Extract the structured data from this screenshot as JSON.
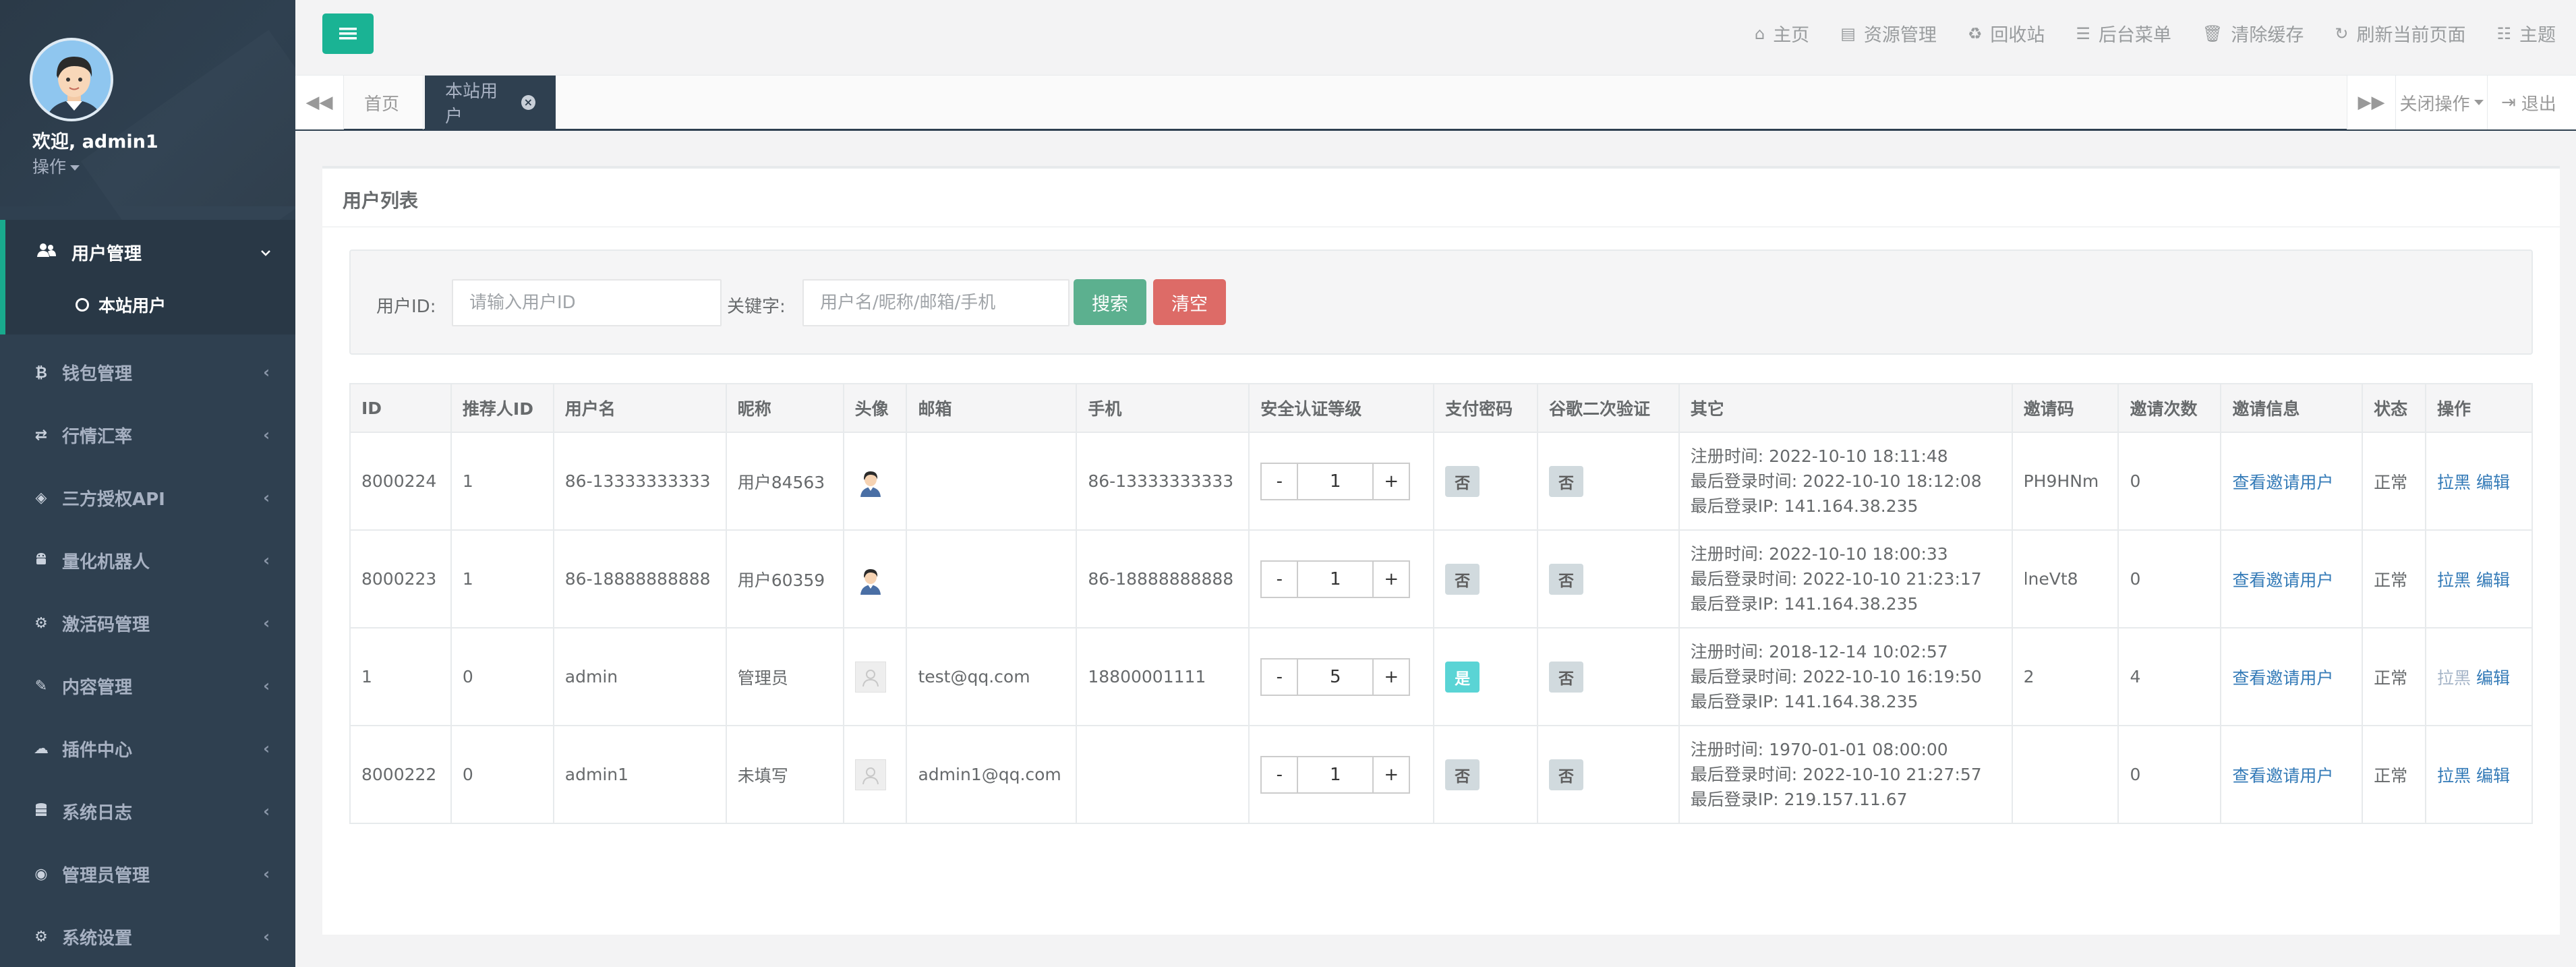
{
  "sidebar": {
    "welcome": "欢迎, admin1",
    "profile_menu": "操作",
    "active_group": {
      "label": "用户管理",
      "sub_item": "本站用户"
    },
    "items": [
      {
        "label": "钱包管理",
        "icon": "bitcoin-icon"
      },
      {
        "label": "行情汇率",
        "icon": "exchange-icon"
      },
      {
        "label": "三方授权API",
        "icon": "api-icon"
      },
      {
        "label": "量化机器人",
        "icon": "android-icon"
      },
      {
        "label": "激活码管理",
        "icon": "gear-icon"
      },
      {
        "label": "内容管理",
        "icon": "edit-icon"
      },
      {
        "label": "插件中心",
        "icon": "cloud-icon"
      },
      {
        "label": "系统日志",
        "icon": "database-icon"
      },
      {
        "label": "管理员管理",
        "icon": "user-circle-icon"
      },
      {
        "label": "系统设置",
        "icon": "gears-icon"
      }
    ]
  },
  "topbar": {
    "links": [
      {
        "label": "主页",
        "icon": "home-icon"
      },
      {
        "label": "资源管理",
        "icon": "file-icon"
      },
      {
        "label": "回收站",
        "icon": "recycle-icon"
      },
      {
        "label": "后台菜单",
        "icon": "list-icon"
      },
      {
        "label": "清除缓存",
        "icon": "trash-icon"
      },
      {
        "label": "刷新当前页面",
        "icon": "refresh-icon"
      },
      {
        "label": "主题",
        "icon": "theme-icon"
      }
    ]
  },
  "tabs": {
    "home": "首页",
    "active": "本站用户",
    "close_ops": "关闭操作",
    "logout": "退出"
  },
  "panel": {
    "title": "用户列表",
    "search": {
      "user_id_label": "用户ID:",
      "user_id_placeholder": "请输入用户ID",
      "keyword_label": "关键字:",
      "keyword_placeholder": "用户名/昵称/邮箱/手机",
      "search_btn": "搜索",
      "clear_btn": "清空"
    }
  },
  "table": {
    "headers": [
      "ID",
      "推荐人ID",
      "用户名",
      "昵称",
      "头像",
      "邮箱",
      "手机",
      "安全认证等级",
      "支付密码",
      "谷歌二次验证",
      "其它",
      "邀请码",
      "邀请次数",
      "邀请信息",
      "状态",
      "操作"
    ],
    "rows": [
      {
        "id": "8000224",
        "ref": "1",
        "username": "86-13333333333",
        "nick": "用户84563",
        "avatar": "man",
        "email": "",
        "phone": "86-13333333333",
        "level": "1",
        "pay": "否",
        "pay_yes": false,
        "google": "否",
        "reg": "注册时间: 2022-10-10 18:11:48",
        "last": "最后登录时间: 2022-10-10 18:12:08",
        "ip": "最后登录IP: 141.164.38.235",
        "code": "PH9HNm",
        "count": "0",
        "invite": "查看邀请用户",
        "status": "正常",
        "black": "拉黑",
        "edit": "编辑",
        "black_muted": false
      },
      {
        "id": "8000223",
        "ref": "1",
        "username": "86-18888888888",
        "nick": "用户60359",
        "avatar": "man",
        "email": "",
        "phone": "86-18888888888",
        "level": "1",
        "pay": "否",
        "pay_yes": false,
        "google": "否",
        "reg": "注册时间: 2022-10-10 18:00:33",
        "last": "最后登录时间: 2022-10-10 21:23:17",
        "ip": "最后登录IP: 141.164.38.235",
        "code": "lneVt8",
        "count": "0",
        "invite": "查看邀请用户",
        "status": "正常",
        "black": "拉黑",
        "edit": "编辑",
        "black_muted": false
      },
      {
        "id": "1",
        "ref": "0",
        "username": "admin",
        "nick": "管理员",
        "avatar": "gray",
        "email": "test@qq.com",
        "phone": "18800001111",
        "level": "5",
        "pay": "是",
        "pay_yes": true,
        "google": "否",
        "reg": "注册时间: 2018-12-14 10:02:57",
        "last": "最后登录时间: 2022-10-10 16:19:50",
        "ip": "最后登录IP: 141.164.38.235",
        "code": "2",
        "count": "4",
        "invite": "查看邀请用户",
        "status": "正常",
        "black": "拉黑",
        "edit": "编辑",
        "black_muted": true
      },
      {
        "id": "8000222",
        "ref": "0",
        "username": "admin1",
        "nick": "未填写",
        "avatar": "gray",
        "email": "admin1@qq.com",
        "phone": "",
        "level": "1",
        "pay": "否",
        "pay_yes": false,
        "google": "否",
        "reg": "注册时间: 1970-01-01 08:00:00",
        "last": "最后登录时间: 2022-10-10 21:27:57",
        "ip": "最后登录IP: 219.157.11.67",
        "code": "",
        "count": "0",
        "invite": "查看邀请用户",
        "status": "正常",
        "black": "拉黑",
        "edit": "编辑",
        "black_muted": false
      }
    ]
  },
  "colors": {
    "sidebar_bg": "#2f4050",
    "accent": "#1ab394",
    "search_btn": "#5cb08f",
    "clear_btn": "#d9534f",
    "link": "#337ab7"
  }
}
